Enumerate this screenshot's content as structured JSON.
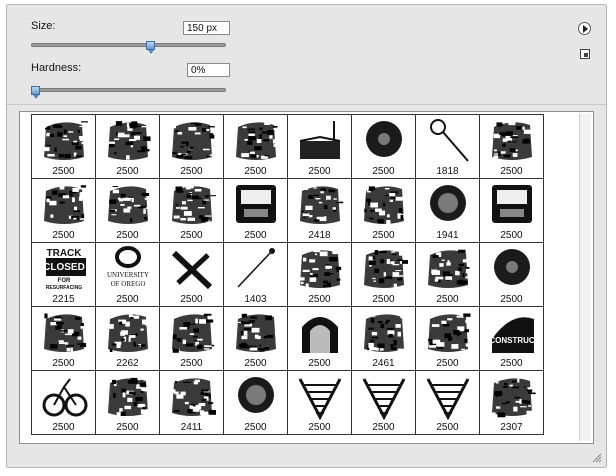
{
  "brush_panel": {
    "size": {
      "label": "Size:",
      "value": "150 px",
      "slider_fraction": 0.62
    },
    "hardness": {
      "label": "Hardness:",
      "value": "0%",
      "slider_fraction": 0.0
    }
  },
  "presets": {
    "cells": [
      {
        "value": "2500",
        "icon": "ink-splatter-icon"
      },
      {
        "value": "2500",
        "icon": "boombox-icon"
      },
      {
        "value": "2500",
        "icon": "rough-texture-icon"
      },
      {
        "value": "2500",
        "icon": "rough-texture-icon"
      },
      {
        "value": "2500",
        "icon": "road-perspective-icon"
      },
      {
        "value": "2500",
        "icon": "dark-blob-icon"
      },
      {
        "value": "1818",
        "icon": "magnifier-icon"
      },
      {
        "value": "2500",
        "icon": "street-scene-icon"
      },
      {
        "value": "2500",
        "icon": "car-photo-icon"
      },
      {
        "value": "2500",
        "icon": "crowd-scene-icon"
      },
      {
        "value": "2500",
        "icon": "abstract-shape-icon"
      },
      {
        "value": "2500",
        "icon": "vehicle-front-icon"
      },
      {
        "value": "2418",
        "icon": "sign-photo-icon"
      },
      {
        "value": "2500",
        "icon": "grass-texture-icon"
      },
      {
        "value": "1941",
        "icon": "globe-icon"
      },
      {
        "value": "2500",
        "icon": "machine-icon"
      },
      {
        "value": "2215",
        "icon": "track-closed-sign-icon",
        "text_lines": [
          "TRACK",
          "CLOSED",
          "FOR",
          "RESURFACING"
        ]
      },
      {
        "value": "2500",
        "icon": "university-logo-icon",
        "text_lines": [
          "UNIVERSITY",
          "OF OREGO"
        ]
      },
      {
        "value": "2500",
        "icon": "crossed-beams-icon"
      },
      {
        "value": "1403",
        "icon": "thin-pole-icon"
      },
      {
        "value": "2500",
        "icon": "crowd-scene-icon"
      },
      {
        "value": "2500",
        "icon": "abstract-shape-icon"
      },
      {
        "value": "2500",
        "icon": "mushroom-cloud-icon"
      },
      {
        "value": "2500",
        "icon": "dark-blob-icon"
      },
      {
        "value": "2500",
        "icon": "abstract-shape-icon"
      },
      {
        "value": "2262",
        "icon": "checkered-debris-icon"
      },
      {
        "value": "2500",
        "icon": "grass-texture-icon"
      },
      {
        "value": "2500",
        "icon": "crouching-figure-icon"
      },
      {
        "value": "2500",
        "icon": "archway-icon"
      },
      {
        "value": "2461",
        "icon": "building-front-icon"
      },
      {
        "value": "2500",
        "icon": "signboard-icon"
      },
      {
        "value": "2500",
        "icon": "construction-sign-icon",
        "text_lines": [
          "CONSTRUC"
        ]
      },
      {
        "value": "2500",
        "icon": "bicycle-icon"
      },
      {
        "value": "2500",
        "icon": "street-scene-icon"
      },
      {
        "value": "2411",
        "icon": "branches-icon"
      },
      {
        "value": "2500",
        "icon": "porthole-icon"
      },
      {
        "value": "2500",
        "icon": "dome-perspective-icon"
      },
      {
        "value": "2500",
        "icon": "structure-perspective-icon"
      },
      {
        "value": "2500",
        "icon": "tower-perspective-icon"
      },
      {
        "value": "2307",
        "icon": "foliage-icon"
      }
    ]
  }
}
